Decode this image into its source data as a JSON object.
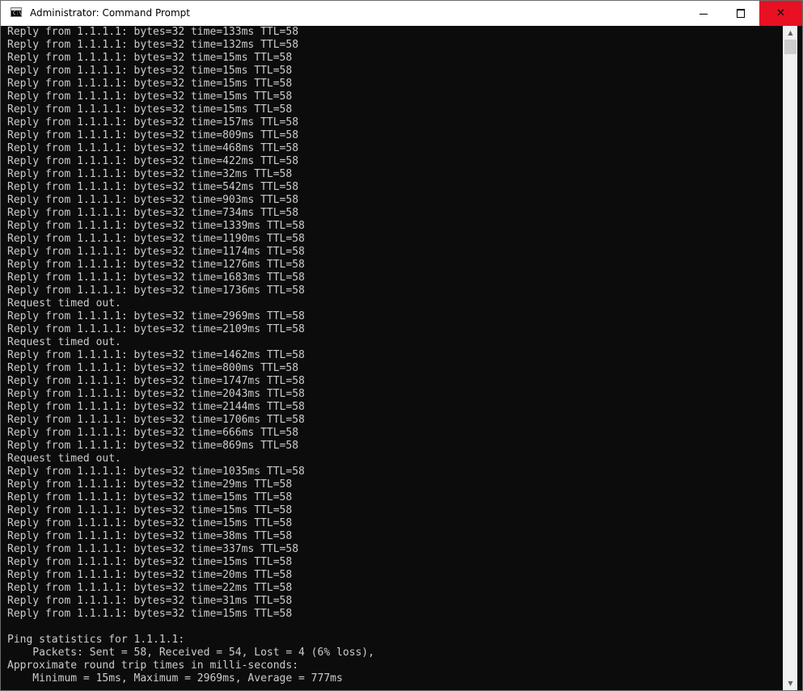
{
  "window": {
    "title": "Administrator: Command Prompt",
    "icon": "cmd-icon",
    "controls": {
      "minimize_icon": "minimize-icon",
      "maximize_icon": "maximize-icon",
      "close_icon": "close-icon",
      "close_glyph": "✕",
      "close_hover_color": "#e81123"
    }
  },
  "console": {
    "background": "#0c0c0c",
    "foreground": "#cccccc",
    "lines": [
      "Reply from 1.1.1.1: bytes=32 time=133ms TTL=58",
      "Reply from 1.1.1.1: bytes=32 time=132ms TTL=58",
      "Reply from 1.1.1.1: bytes=32 time=15ms TTL=58",
      "Reply from 1.1.1.1: bytes=32 time=15ms TTL=58",
      "Reply from 1.1.1.1: bytes=32 time=15ms TTL=58",
      "Reply from 1.1.1.1: bytes=32 time=15ms TTL=58",
      "Reply from 1.1.1.1: bytes=32 time=15ms TTL=58",
      "Reply from 1.1.1.1: bytes=32 time=157ms TTL=58",
      "Reply from 1.1.1.1: bytes=32 time=809ms TTL=58",
      "Reply from 1.1.1.1: bytes=32 time=468ms TTL=58",
      "Reply from 1.1.1.1: bytes=32 time=422ms TTL=58",
      "Reply from 1.1.1.1: bytes=32 time=32ms TTL=58",
      "Reply from 1.1.1.1: bytes=32 time=542ms TTL=58",
      "Reply from 1.1.1.1: bytes=32 time=903ms TTL=58",
      "Reply from 1.1.1.1: bytes=32 time=734ms TTL=58",
      "Reply from 1.1.1.1: bytes=32 time=1339ms TTL=58",
      "Reply from 1.1.1.1: bytes=32 time=1190ms TTL=58",
      "Reply from 1.1.1.1: bytes=32 time=1174ms TTL=58",
      "Reply from 1.1.1.1: bytes=32 time=1276ms TTL=58",
      "Reply from 1.1.1.1: bytes=32 time=1683ms TTL=58",
      "Reply from 1.1.1.1: bytes=32 time=1736ms TTL=58",
      "Request timed out.",
      "Reply from 1.1.1.1: bytes=32 time=2969ms TTL=58",
      "Reply from 1.1.1.1: bytes=32 time=2109ms TTL=58",
      "Request timed out.",
      "Reply from 1.1.1.1: bytes=32 time=1462ms TTL=58",
      "Reply from 1.1.1.1: bytes=32 time=800ms TTL=58",
      "Reply from 1.1.1.1: bytes=32 time=1747ms TTL=58",
      "Reply from 1.1.1.1: bytes=32 time=2043ms TTL=58",
      "Reply from 1.1.1.1: bytes=32 time=2144ms TTL=58",
      "Reply from 1.1.1.1: bytes=32 time=1706ms TTL=58",
      "Reply from 1.1.1.1: bytes=32 time=666ms TTL=58",
      "Reply from 1.1.1.1: bytes=32 time=869ms TTL=58",
      "Request timed out.",
      "Reply from 1.1.1.1: bytes=32 time=1035ms TTL=58",
      "Reply from 1.1.1.1: bytes=32 time=29ms TTL=58",
      "Reply from 1.1.1.1: bytes=32 time=15ms TTL=58",
      "Reply from 1.1.1.1: bytes=32 time=15ms TTL=58",
      "Reply from 1.1.1.1: bytes=32 time=15ms TTL=58",
      "Reply from 1.1.1.1: bytes=32 time=38ms TTL=58",
      "Reply from 1.1.1.1: bytes=32 time=337ms TTL=58",
      "Reply from 1.1.1.1: bytes=32 time=15ms TTL=58",
      "Reply from 1.1.1.1: bytes=32 time=20ms TTL=58",
      "Reply from 1.1.1.1: bytes=32 time=22ms TTL=58",
      "Reply from 1.1.1.1: bytes=32 time=31ms TTL=58",
      "Reply from 1.1.1.1: bytes=32 time=15ms TTL=58",
      "",
      "Ping statistics for 1.1.1.1:",
      "    Packets: Sent = 58, Received = 54, Lost = 4 (6% loss),",
      "Approximate round trip times in milli-seconds:",
      "    Minimum = 15ms, Maximum = 2969ms, Average = 777ms"
    ]
  },
  "scrollbar": {
    "up_icon": "scroll-up-arrow-icon",
    "down_icon": "scroll-down-arrow-icon",
    "position": 0.0
  }
}
